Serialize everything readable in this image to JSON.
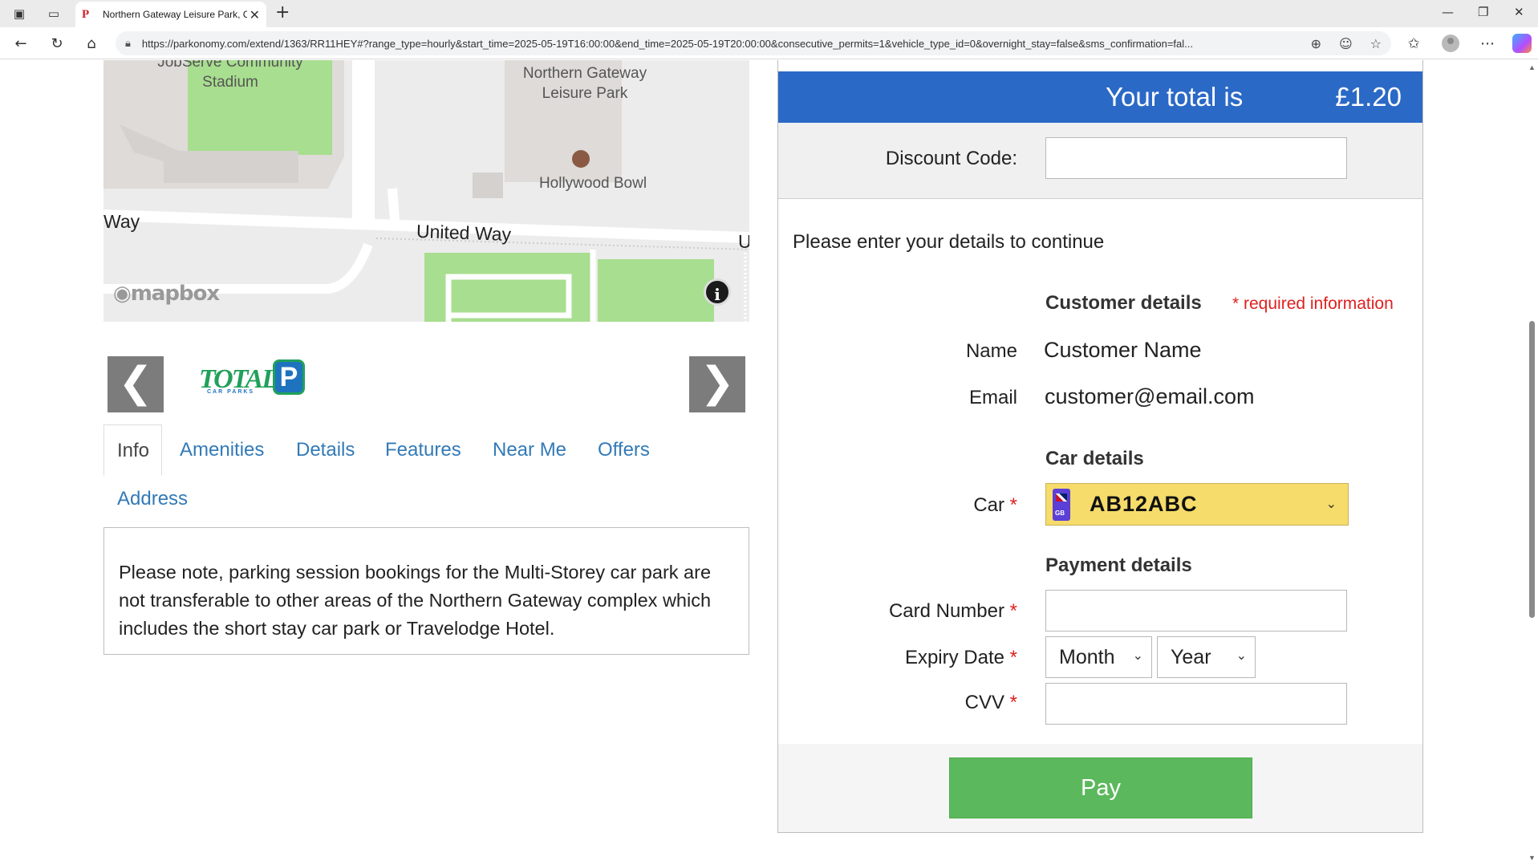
{
  "browser": {
    "tab_title": "Northern Gateway Leisure Park, C",
    "tab_favicon": "P",
    "url": "https://parkonomy.com/extend/1363/RR11HEY#?range_type=hourly&start_time=2025-05-19T16:00:00&end_time=2025-05-19T20:00:00&consecutive_permits=1&vehicle_type_id=0&overnight_stay=false&sms_confirmation=fal..."
  },
  "map": {
    "labels": {
      "stadium_line1": "JobServe Community",
      "stadium_line2": "Stadium",
      "leisure_line1": "Northern Gateway",
      "leisure_line2": "Leisure Park",
      "bowl": "Hollywood Bowl",
      "road_left": "Way",
      "road_main": "United Way",
      "road_right": "U"
    },
    "attribution": "mapbox",
    "info_glyph": "i"
  },
  "carousel": {
    "prev": "❮",
    "next": "❯",
    "logo_text": "TOTAL",
    "logo_p": "P",
    "logo_sub": "CAR PARKS"
  },
  "tabs": {
    "items": [
      "Info",
      "Amenities",
      "Details",
      "Features",
      "Near Me",
      "Offers"
    ],
    "second_row": "Address",
    "active": "Info"
  },
  "info_text": "Please note, parking session bookings for the Multi-Storey car park are not transferable to other areas of the Northern Gateway complex which includes the short stay car park or Travelodge Hotel.",
  "checkout": {
    "total_label": "Your total is",
    "total_value": "£1.20",
    "discount_label": "Discount Code:",
    "discount_value": "",
    "intro": "Please enter your details to continue",
    "customer_heading": "Customer details",
    "required_note": "* required information",
    "name_label": "Name",
    "name_value": "Customer Name",
    "email_label": "Email",
    "email_value": "customer@email.com",
    "car_heading": "Car details",
    "car_label": "Car",
    "car_plate": "AB12ABC",
    "plate_country": "GB",
    "payment_heading": "Payment details",
    "card_label": "Card Number",
    "expiry_label": "Expiry Date",
    "month_placeholder": "Month",
    "year_placeholder": "Year",
    "cvv_label": "CVV",
    "required_mark": "*",
    "pay_button": "Pay"
  },
  "colors": {
    "total_bar": "#2b69c6",
    "link": "#337ab7",
    "required": "#e02020",
    "pay": "#5cb85c",
    "plate": "#f5dc6b"
  }
}
